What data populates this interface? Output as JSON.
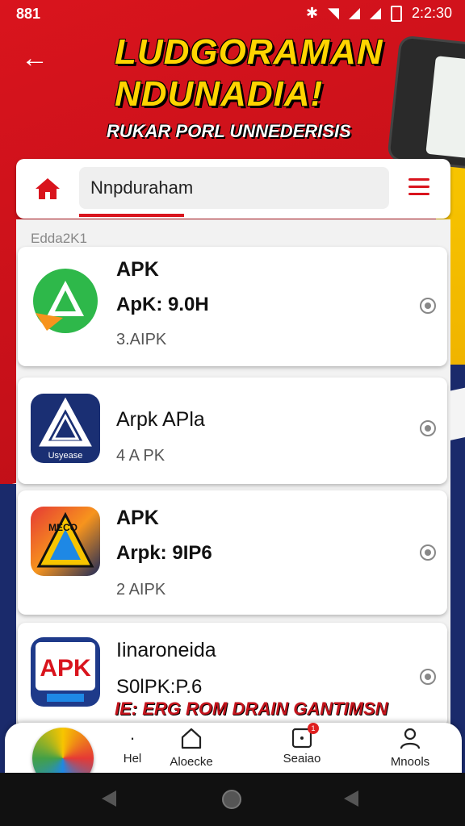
{
  "status_bar": {
    "time_left": "881",
    "time_right": "2:2:30"
  },
  "header": {
    "title_line1": "LUDGORAMAN",
    "title_line2": "NDUNADIA!",
    "subtitle": "RUKAR PORL UNNEDERISIS"
  },
  "search": {
    "value": "Nnpduraham"
  },
  "section_label": "Edda2K1",
  "apps": [
    {
      "name": "APK",
      "line2": "ApK: 9.0H",
      "line3": "3.AIPK"
    },
    {
      "name": "Arpk APla",
      "line2": "",
      "line3": "4 A PK",
      "icon_text": "Usyease"
    },
    {
      "name": "APK",
      "line2": "Arpk: 9IP6",
      "line3": "2 AIPK",
      "icon_text": "MECO"
    },
    {
      "name": "Iinaroneida",
      "line2": "S0lPK:P.6",
      "line3": "",
      "icon_text": "APK"
    }
  ],
  "promo_text": "IE: ERG ROM DRAIN GANTIMSN",
  "bottom_nav": [
    {
      "label": "Hel",
      "icon": "star-icon"
    },
    {
      "label": "Aloecke",
      "icon": "home-outline-icon"
    },
    {
      "label": "Seaiao",
      "icon": "notification-icon",
      "badge": "1"
    },
    {
      "label": "Mnools",
      "icon": "profile-icon"
    }
  ],
  "colors": {
    "brand_red": "#d9141d",
    "title_yellow": "#ffd400",
    "navy": "#1a2a6b"
  }
}
